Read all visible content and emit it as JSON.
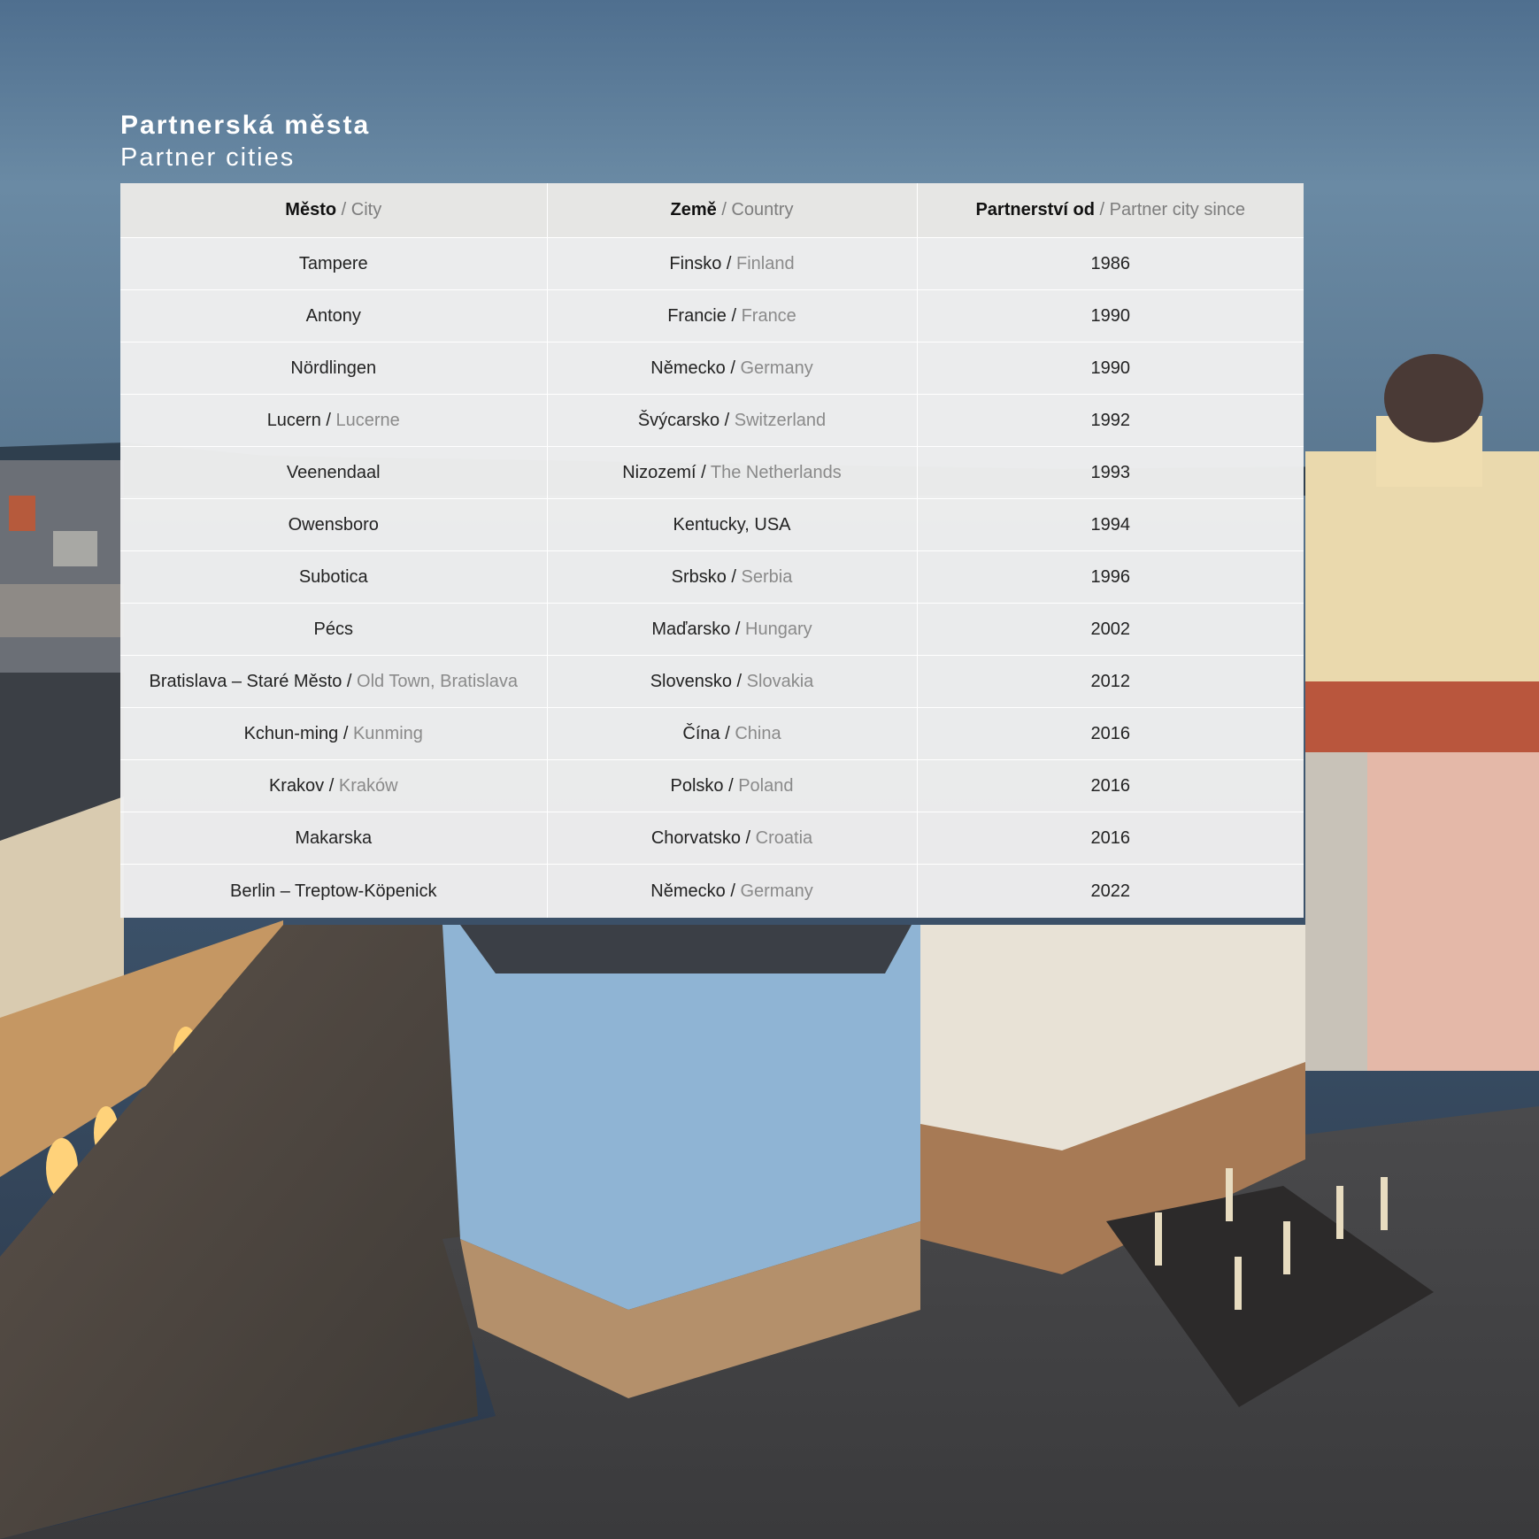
{
  "titles": {
    "cz": "Partnerská města",
    "en": "Partner cities"
  },
  "table": {
    "headers": [
      {
        "main": "Město",
        "sub": " / City"
      },
      {
        "main": "Země",
        "sub": " / Country"
      },
      {
        "main": "Partnerství od",
        "sub": " / Partner city since"
      }
    ],
    "rows": [
      {
        "city": "Tampere",
        "city_en": "",
        "country": "Finsko",
        "country_en": "Finland",
        "since": "1986"
      },
      {
        "city": "Antony",
        "city_en": "",
        "country": "Francie",
        "country_en": "France",
        "since": "1990"
      },
      {
        "city": "Nördlingen",
        "city_en": "",
        "country": "Německo",
        "country_en": "Germany",
        "since": "1990"
      },
      {
        "city": "Lucern",
        "city_en": "Lucerne",
        "country": "Švýcarsko",
        "country_en": "Switzerland",
        "since": "1992"
      },
      {
        "city": "Veenendaal",
        "city_en": "",
        "country": "Nizozemí",
        "country_en": "The Netherlands",
        "since": "1993"
      },
      {
        "city": "Owensboro",
        "city_en": "",
        "country": "Kentucky, USA",
        "country_en": "",
        "since": "1994"
      },
      {
        "city": "Subotica",
        "city_en": "",
        "country": "Srbsko",
        "country_en": "Serbia",
        "since": "1996"
      },
      {
        "city": "Pécs",
        "city_en": "",
        "country": "Maďarsko",
        "country_en": "Hungary",
        "since": "2002"
      },
      {
        "city": "Bratislava – Staré Město",
        "city_en": "Old Town, Bratislava",
        "country": "Slovensko",
        "country_en": "Slovakia",
        "since": "2012"
      },
      {
        "city": "Kchun-ming",
        "city_en": "Kunming",
        "country": "Čína",
        "country_en": "China",
        "since": "2016"
      },
      {
        "city": "Krakov",
        "city_en": "Kraków",
        "country": "Polsko",
        "country_en": "Poland",
        "since": "2016"
      },
      {
        "city": "Makarska",
        "city_en": "",
        "country": "Chorvatsko",
        "country_en": "Croatia",
        "since": "2016"
      },
      {
        "city": "Berlin – Treptow-Köpenick",
        "city_en": "",
        "country": "Německo",
        "country_en": "Germany",
        "since": "2022"
      }
    ]
  }
}
